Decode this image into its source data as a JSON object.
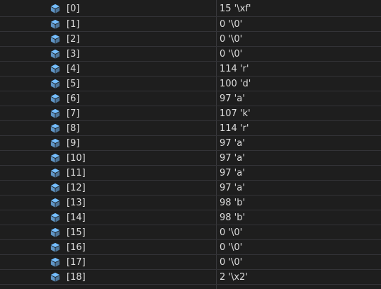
{
  "watch": {
    "icon": "field-cube-icon",
    "icon_color": "#75beff",
    "rows": [
      {
        "name": "[0]",
        "value": "15 '\\xf'"
      },
      {
        "name": "[1]",
        "value": "0 '\\0'"
      },
      {
        "name": "[2]",
        "value": "0 '\\0'"
      },
      {
        "name": "[3]",
        "value": "0 '\\0'"
      },
      {
        "name": "[4]",
        "value": "114 'r'"
      },
      {
        "name": "[5]",
        "value": "100 'd'"
      },
      {
        "name": "[6]",
        "value": "97 'a'"
      },
      {
        "name": "[7]",
        "value": "107 'k'"
      },
      {
        "name": "[8]",
        "value": "114 'r'"
      },
      {
        "name": "[9]",
        "value": "97 'a'"
      },
      {
        "name": "[10]",
        "value": "97 'a'"
      },
      {
        "name": "[11]",
        "value": "97 'a'"
      },
      {
        "name": "[12]",
        "value": "97 'a'"
      },
      {
        "name": "[13]",
        "value": "98 'b'"
      },
      {
        "name": "[14]",
        "value": "98 'b'"
      },
      {
        "name": "[15]",
        "value": "0 '\\0'"
      },
      {
        "name": "[16]",
        "value": "0 '\\0'"
      },
      {
        "name": "[17]",
        "value": "0 '\\0'"
      },
      {
        "name": "[18]",
        "value": "2 '\\x2'"
      }
    ]
  }
}
